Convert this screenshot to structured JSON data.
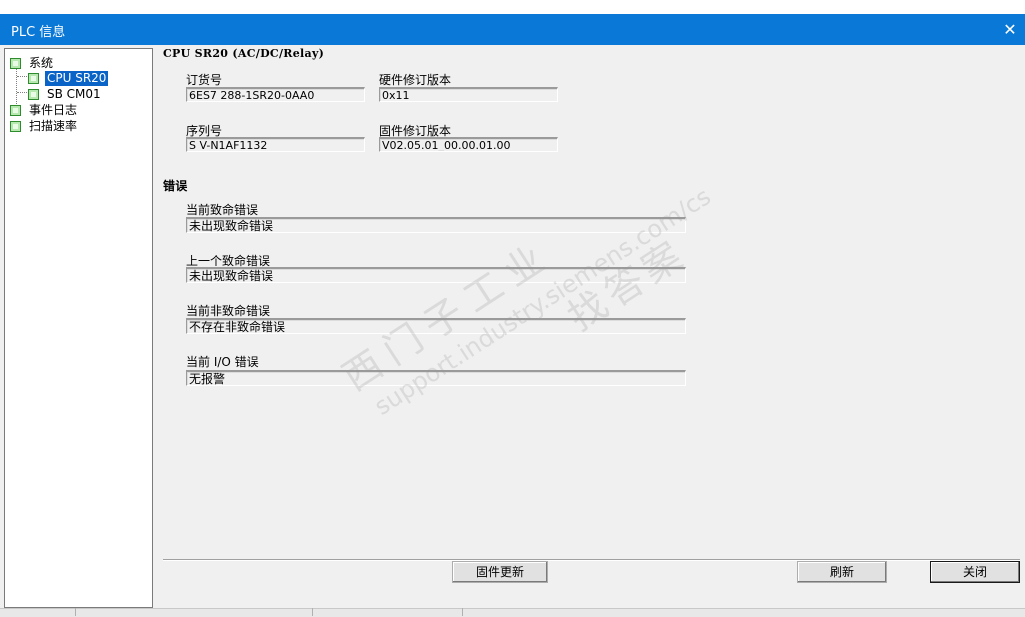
{
  "window": {
    "title": "PLC 信息",
    "close_glyph": "✕"
  },
  "tree": {
    "items": [
      {
        "label": "系统"
      },
      {
        "label": "CPU SR20"
      },
      {
        "label": "SB CM01"
      },
      {
        "label": "事件日志"
      },
      {
        "label": "扫描速率"
      }
    ],
    "selected": "CPU SR20"
  },
  "device": {
    "header": "CPU SR20 (AC/DC/Relay)",
    "order_number_label": "订货号",
    "order_number": "6ES7 288-1SR20-0AA0",
    "hw_revision_label": "硬件修订版本",
    "hw_revision": "0x11",
    "serial_label": "序列号",
    "serial": "S V-N1AF1132",
    "fw_revision_label": "固件修订版本",
    "fw_revision": "V02.05.01_00.00.01.00"
  },
  "errors": {
    "header": "错误",
    "current_fatal_label": "当前致命错误",
    "current_fatal": "未出现致命错误",
    "last_fatal_label": "上一个致命错误",
    "last_fatal": "未出现致命错误",
    "current_nonfatal_label": "当前非致命错误",
    "current_nonfatal": "不存在非致命错误",
    "current_io_label": "当前 I/O 错误",
    "current_io": "无报警"
  },
  "buttons": {
    "firmware_update": "固件更新",
    "refresh": "刷新",
    "close": "关闭"
  },
  "watermark": {
    "text1": "西门子工业",
    "text2": "找答案",
    "url": "support.industry.siemens.com/cs"
  },
  "colors": {
    "titlebar": "#0a78d7",
    "selection": "#0a64c8",
    "tree_box": "#b6e8b0"
  }
}
